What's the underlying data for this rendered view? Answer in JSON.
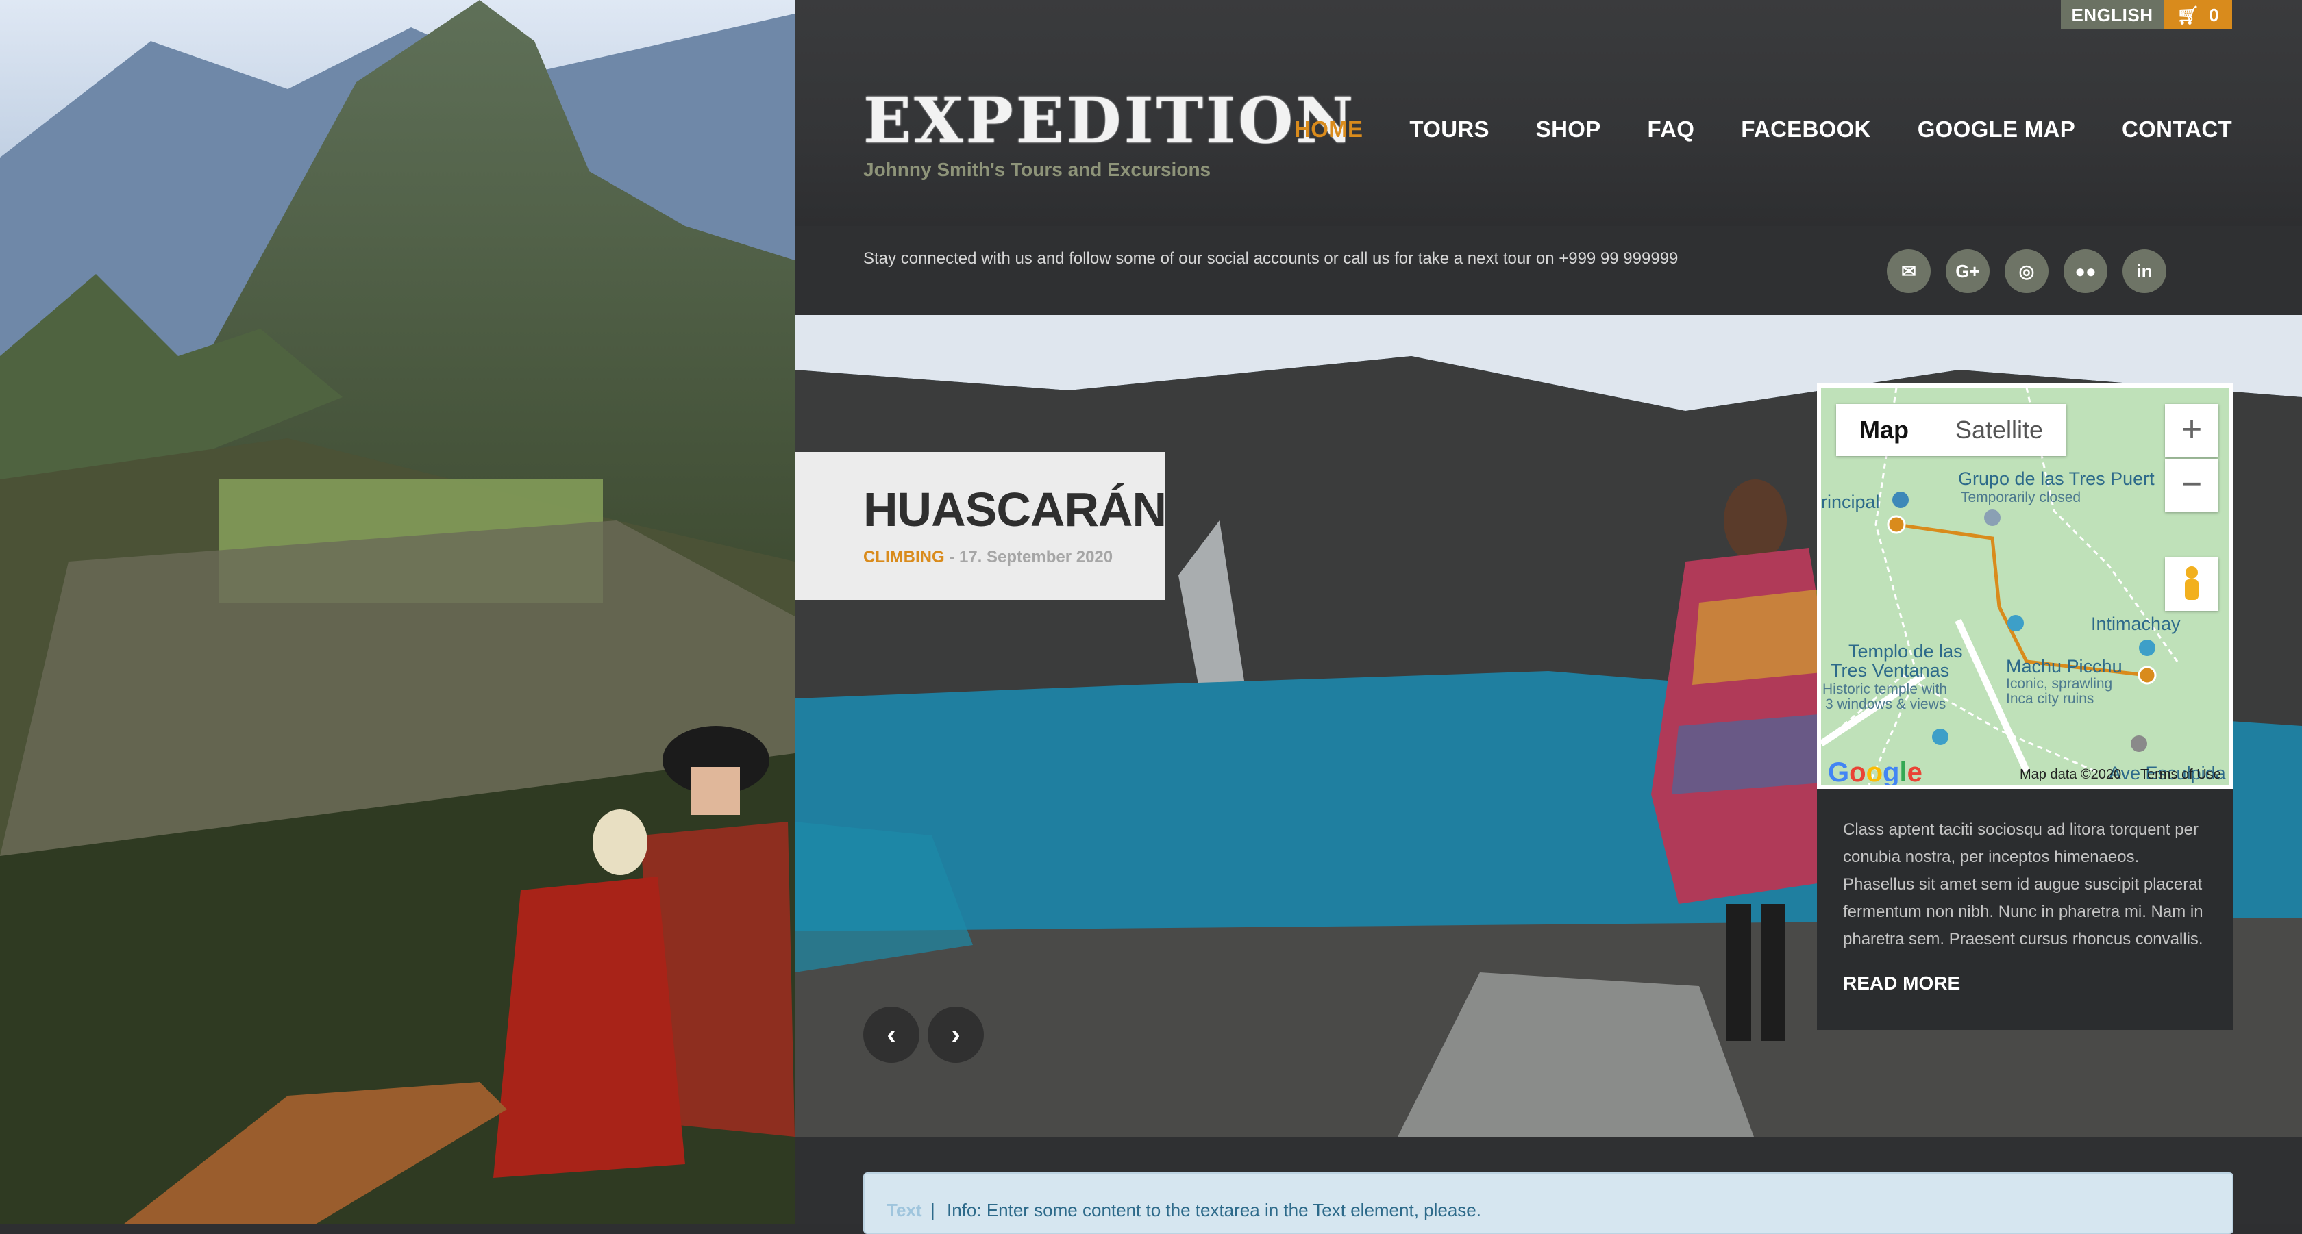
{
  "topbar": {
    "language": "ENGLISH",
    "cart_count": "0",
    "cart_icon": "cart-icon"
  },
  "brand": {
    "logo": "EXPEDITION",
    "tagline": "Johnny Smith's Tours and Excursions"
  },
  "nav": [
    {
      "label": "HOME",
      "active": true
    },
    {
      "label": "TOURS",
      "active": false
    },
    {
      "label": "SHOP",
      "active": false
    },
    {
      "label": "FAQ",
      "active": false
    },
    {
      "label": "FACEBOOK",
      "active": false
    },
    {
      "label": "GOOGLE MAP",
      "active": false
    },
    {
      "label": "CONTACT",
      "active": false
    }
  ],
  "social": {
    "text": "Stay connected with us and follow some of our social accounts or call us for take a next tour on +999 99 999999",
    "icons": [
      {
        "name": "mail-icon",
        "glyph": "✉"
      },
      {
        "name": "google-plus-icon",
        "glyph": "G+"
      },
      {
        "name": "dribbble-icon",
        "glyph": "◎"
      },
      {
        "name": "flickr-icon",
        "glyph": "●●"
      },
      {
        "name": "linkedin-icon",
        "glyph": "in"
      }
    ]
  },
  "slide": {
    "title": "HUASCARÁN",
    "category": "CLIMBING",
    "separator": " - ",
    "date": "17. September 2020",
    "prev_glyph": "‹",
    "next_glyph": "›"
  },
  "map": {
    "tab_map": "Map",
    "tab_satellite": "Satellite",
    "zoom_in": "+",
    "zoom_out": "−",
    "labels": {
      "principal": "rincipal",
      "grupo": "Grupo de las Tres Puert",
      "grupo_sub": "Temporarily closed",
      "intimachay": "Intimachay",
      "templo1": "Templo de las",
      "templo2": "Tres Ventanas",
      "templo_sub1": "Historic temple with",
      "templo_sub2": "3 windows & views",
      "machu": "Machu Picchu",
      "machu_sub1": "Iconic, sprawling",
      "machu_sub2": "Inca city ruins",
      "ave": "Ave Esculpida"
    },
    "google": "Google",
    "map_data": "Map data ©2020",
    "terms": "Terms of Use"
  },
  "info": {
    "text": "Class aptent taciti sociosqu ad litora torquent per conubia nostra, per inceptos himenaeos. Phasellus sit amet sem id augue suscipit placerat fermentum non nibh. Nunc in pharetra mi. Nam in pharetra sem. Praesent cursus rhoncus convallis.",
    "read_more": "READ MORE"
  },
  "notice": {
    "tag": "Text",
    "pipe": "|",
    "message": "Info: Enter some content to the textarea in the Text element, please."
  },
  "colors": {
    "accent": "#d98b1c",
    "lang_bg": "#6b7263",
    "header_bg": "#343537"
  }
}
